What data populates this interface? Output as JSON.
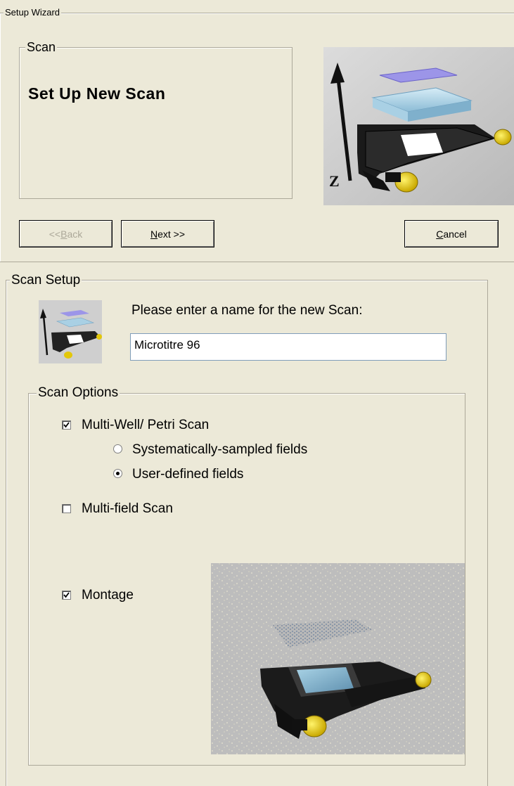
{
  "wizard": {
    "title": "Setup Wizard"
  },
  "scan_panel": {
    "legend": "Scan",
    "heading": "Set Up New Scan"
  },
  "nav": {
    "back_prefix": "<< ",
    "back_key": "B",
    "back_rest": "ack",
    "next_key": "N",
    "next_rest": "ext >>",
    "cancel_key": "C",
    "cancel_rest": "ancel"
  },
  "scan_setup": {
    "legend": "Scan Setup",
    "name_prompt": "Please enter a name for the new Scan:",
    "name_value": "Microtitre 96"
  },
  "scan_options": {
    "legend": "Scan Options",
    "multi_well": {
      "label": "Multi-Well/ Petri Scan",
      "checked": true
    },
    "systematic": {
      "label": "Systematically-sampled fields",
      "selected": false
    },
    "user_defined": {
      "label": "User-defined fields",
      "selected": true
    },
    "multi_field": {
      "label": "Multi-field Scan",
      "checked": false
    },
    "montage": {
      "label": "Montage",
      "checked": true
    }
  },
  "images": {
    "hero": "stage-with-plate-z-axis-illustration",
    "thumb": "stage-thumbnail-icon",
    "montage": "montage-stage-illustration"
  }
}
